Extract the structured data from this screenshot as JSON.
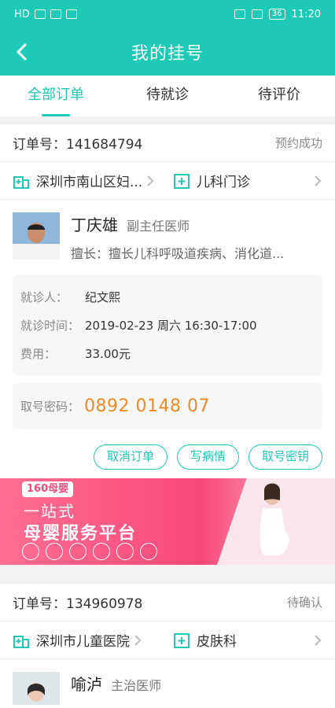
{
  "status_bar": {
    "left": "HD",
    "time": "11:20",
    "battery": "36"
  },
  "nav": {
    "title": "我的挂号"
  },
  "tabs": [
    "全部订单",
    "待就诊",
    "待评价"
  ],
  "orders": [
    {
      "order_label": "订单号：141684794",
      "status": "预约成功",
      "hospital": "深圳市南山区妇...",
      "department": "儿科门诊",
      "doctor_name": "丁庆雄",
      "doctor_title": "副主任医师",
      "specialty": "擅长：擅长儿科呼吸道疾病、消化道...",
      "patient_label": "就诊人：",
      "patient": "纪文熙",
      "time_label": "就诊时间：",
      "time": "2019-02-23 周六 16:30-17:00",
      "fee_label": "费用：",
      "fee": "33.00元",
      "code_label": "取号密码：",
      "code": "0892 0148 07",
      "buttons": [
        "取消订单",
        "写病情",
        "取号密钥"
      ]
    },
    {
      "order_label": "订单号：134960978",
      "status": "待确认",
      "hospital": "深圳市儿童医院",
      "department": "皮肤科",
      "doctor_name": "喻泸",
      "doctor_title": "主治医师"
    }
  ],
  "banner": {
    "brand": "160母婴",
    "line1": "一站式",
    "line2": "母婴服务平台"
  },
  "colors": {
    "accent": "#1fc9b7",
    "code": "#f08a24"
  }
}
